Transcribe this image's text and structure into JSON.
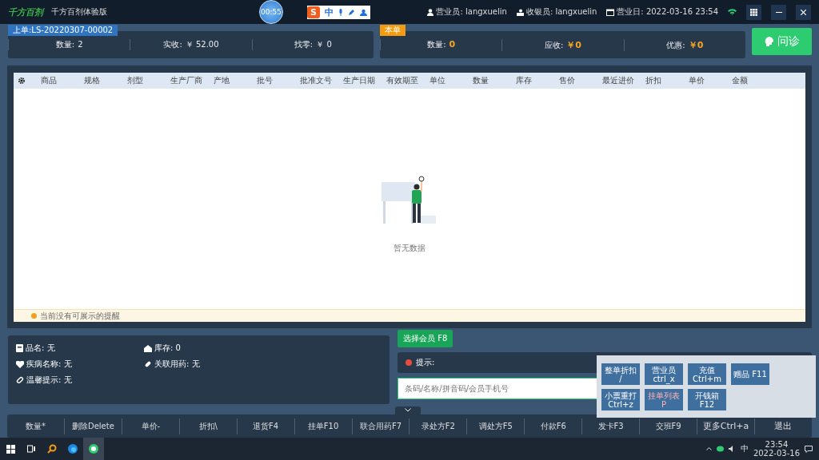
{
  "app": {
    "logo": "千方百剂",
    "title": "千方百剂体验版",
    "timer": "00:55"
  },
  "ime_bar": {
    "logo": "S",
    "mode": "中"
  },
  "header": {
    "salesperson": "营业员: langxuelin",
    "cashier": "收银员: langxuelin",
    "business_day": "营业日: 2022-03-16 23:54"
  },
  "last_order": {
    "tag": "上单:LS-20220307-00002",
    "fields": [
      {
        "label": "数量:",
        "value": "2"
      },
      {
        "label": "实收:",
        "value": "￥ 52.00"
      },
      {
        "label": "找零:",
        "value": "￥ 0"
      }
    ]
  },
  "this_order": {
    "tag": "本单",
    "fields": [
      {
        "label": "数量:",
        "value": "0"
      },
      {
        "label": "应收:",
        "value": "￥0"
      },
      {
        "label": "优惠:",
        "value": "￥0"
      }
    ]
  },
  "consult_button": "问诊",
  "table": {
    "columns": [
      "商品",
      "规格",
      "剂型",
      "生产厂商",
      "产地",
      "批号",
      "批准文号",
      "生产日期",
      "有效期至",
      "单位",
      "数量",
      "库存",
      "售价",
      "最近进价",
      "折扣",
      "单价",
      "金额"
    ],
    "empty_text": "暂无数据",
    "notice": "当前没有可展示的提醒"
  },
  "info": [
    {
      "kind": "box",
      "label": "品名: 无"
    },
    {
      "kind": "house",
      "label": "库存: 0"
    },
    {
      "kind": "heart",
      "label": "疾病名称: 无"
    },
    {
      "kind": "pill",
      "label": "关联用药: 无"
    },
    {
      "kind": "link",
      "label": "温馨提示: 无"
    }
  ],
  "member_button": "选择会员 F8",
  "hint": "提示:",
  "search": {
    "placeholder": "条码/名称/拼音码/会员手机号"
  },
  "more_menu": [
    {
      "label": "整单折扣 /",
      "warning": false
    },
    {
      "label": "营业员 ctrl_x",
      "warning": false
    },
    {
      "label": "充值 Ctrl+m",
      "warning": false
    },
    {
      "label": "赠品 F11",
      "warning": false
    },
    {
      "label": "小票重打 Ctrl+z",
      "warning": false
    },
    {
      "label": "挂单列表 P",
      "warning": true
    },
    {
      "label": "开钱箱 F12",
      "warning": false
    }
  ],
  "functions": [
    "数量*",
    "删除Delete",
    "单价-",
    "折扣\\",
    "退货F4",
    "挂单F10",
    "联合用药F7",
    "录处方F2",
    "调处方F5",
    "付款F6",
    "发卡F3",
    "交班F9",
    "更多Ctrl+a",
    "退出"
  ],
  "taskbar": {
    "ime": "中",
    "time": "23:54",
    "date": "2022-03-16"
  }
}
